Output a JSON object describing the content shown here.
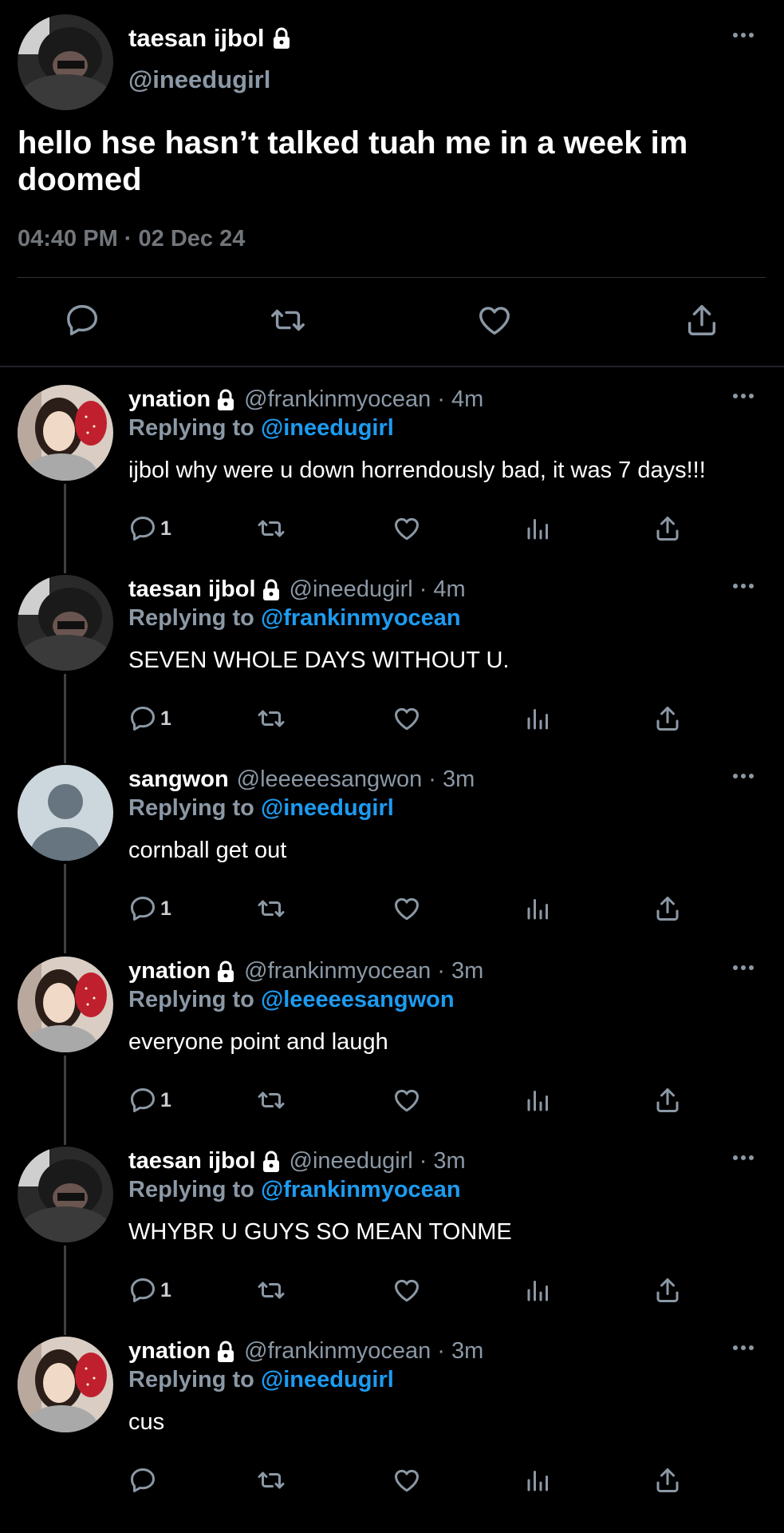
{
  "main_tweet": {
    "name": "taesan ijbol",
    "handle": "@ineedugirl",
    "text": "hello hse hasn’t talked tuah me in a week im doomed",
    "timestamp": "04:40 PM · 02 Dec 24",
    "avatar_icon": "profile-photo-masked",
    "more_icon": "more-dots-icon",
    "actions": [
      "reply-icon",
      "retweet-icon",
      "like-icon",
      "share-icon"
    ]
  },
  "replies": [
    {
      "name": "ynation",
      "handle": "@frankinmyocean",
      "dot": "·",
      "time": "4m",
      "replying_label": "Replying to",
      "replying_to": "@ineedugirl",
      "text": "ijbol why were u down horrendously bad, it was 7 days!!!",
      "reply_count": "1"
    },
    {
      "name": "taesan ijbol",
      "handle": "@ineedugirl",
      "dot": "·",
      "time": "4m",
      "replying_label": "Replying to",
      "replying_to": "@frankinmyocean",
      "text": "SEVEN WHOLE DAYS WITHOUT U.",
      "reply_count": "1"
    },
    {
      "name": "sangwon",
      "handle": "@leeeeesangwon",
      "dot": "·",
      "time": "3m",
      "replying_label": "Replying to",
      "replying_to": "@ineedugirl",
      "text": "cornball get out",
      "reply_count": "1"
    },
    {
      "name": "ynation",
      "handle": "@frankinmyocean",
      "dot": "·",
      "time": "3m",
      "replying_label": "Replying to",
      "replying_to": "@leeeeesangwon",
      "text": "everyone point and laugh",
      "reply_count": "1"
    },
    {
      "name": "taesan ijbol",
      "handle": "@ineedugirl",
      "dot": "·",
      "time": "3m",
      "replying_label": "Replying to",
      "replying_to": "@frankinmyocean",
      "text": "WHYBR U GUYS SO MEAN TONME",
      "reply_count": "1"
    },
    {
      "name": "ynation",
      "handle": "@frankinmyocean",
      "dot": "·",
      "time": "3m",
      "replying_label": "Replying to",
      "replying_to": "@ineedugirl",
      "text": "cus",
      "reply_count": ""
    }
  ],
  "colors": {
    "background": "#000000",
    "text": "#ffffff",
    "muted": "#8b98a5",
    "mention": "#1d9bf0",
    "icon": "#8b98a5"
  }
}
